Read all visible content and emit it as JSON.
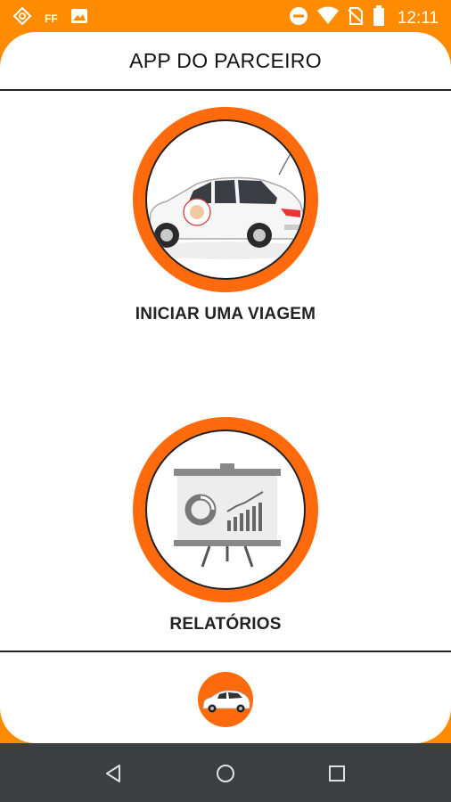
{
  "status_bar": {
    "time": "12:11",
    "notification_text": "FF",
    "icons": [
      "app-notification-icon",
      "ff-notification-icon",
      "image-notification-icon",
      "do-not-disturb-icon",
      "wifi-icon",
      "no-sim-icon",
      "battery-icon"
    ]
  },
  "header": {
    "title": "APP DO PARCEIRO"
  },
  "menu": {
    "start_trip_label": "INICIAR UMA VIAGEM",
    "reports_label": "RELATÓRIOS"
  },
  "bottom_nav": {
    "icon": "car-icon"
  },
  "system_nav": {
    "icons": [
      "back-icon",
      "home-icon",
      "recents-icon"
    ]
  },
  "colors": {
    "status_bar": "#ff8c00",
    "accent": "#ff6a0d",
    "nav_bar": "#3b3f42",
    "text": "#222222"
  }
}
